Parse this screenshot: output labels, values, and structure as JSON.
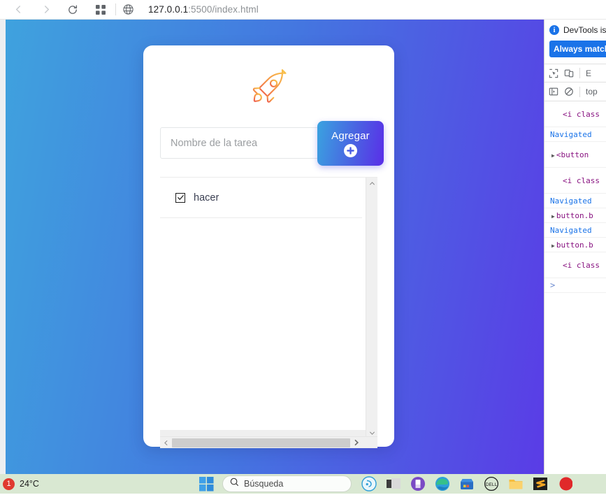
{
  "browser": {
    "back_label": "Back",
    "forward_label": "Forward",
    "reload_label": "Reload",
    "tabs_label": "Tab search",
    "url_host": "127.0.0.1",
    "url_path": ":5500/index.html"
  },
  "app": {
    "logo_icon": "rocket-icon",
    "input": {
      "value": "",
      "placeholder": "Nombre de la tarea"
    },
    "add_button": {
      "label": "Agregar",
      "icon": "plus-circle-icon"
    },
    "tasks": [
      {
        "label": "hacer",
        "checked": true
      }
    ],
    "scroll": {
      "v_up_icon": "chevron-up-icon",
      "v_down_icon": "chevron-down-icon",
      "h_left_icon": "chevron-left-icon",
      "h_right_icon": "chevron-right-icon"
    },
    "colors": {
      "bg_gradient_start": "#3fa2de",
      "bg_gradient_end": "#5a3ce6",
      "button_gradient_start": "#3aa3e0",
      "button_gradient_end": "#5a2ee8",
      "rocket_start": "#f8c14a",
      "rocket_end": "#ef5f4c"
    }
  },
  "devtools": {
    "notice_text": "DevTools is",
    "notice_icon": "info-icon",
    "always_match_label": "Always match",
    "toolbar": {
      "inspect_icon": "inspect-element-icon",
      "device_icon": "device-toolbar-icon",
      "elements_tab": "E",
      "sidebar_icon": "console-sidebar-icon",
      "clear_icon": "clear-console-icon",
      "context": "top"
    },
    "console_rows": [
      {
        "kind": "html",
        "text": "<i class"
      },
      {
        "kind": "nav",
        "text": "Navigated"
      },
      {
        "kind": "node",
        "text": "<button"
      },
      {
        "kind": "html",
        "text": "<i class"
      },
      {
        "kind": "nav",
        "text": "Navigated"
      },
      {
        "kind": "node",
        "text": "button.b"
      },
      {
        "kind": "nav",
        "text": "Navigated"
      },
      {
        "kind": "node",
        "text": "button.b"
      },
      {
        "kind": "html",
        "text": "<i class"
      }
    ],
    "prompt": ">"
  },
  "taskbar": {
    "weather_badge": "1",
    "weather_temp": "24°C",
    "start_label": "Start",
    "search_placeholder": "Búsqueda",
    "icons": [
      "copilot-icon",
      "task-view-icon",
      "app-purple-icon",
      "edge-icon",
      "microsoft-store-icon",
      "dell-icon",
      "file-explorer-icon",
      "sublime-text-icon",
      "red-app-icon"
    ]
  }
}
